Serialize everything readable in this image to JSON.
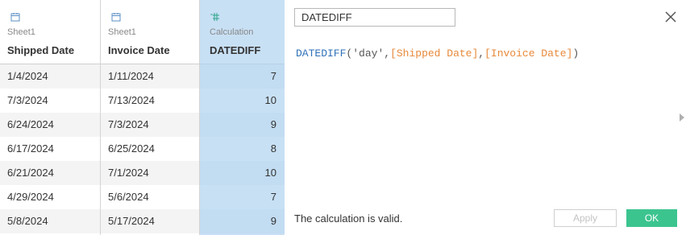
{
  "columns": [
    {
      "source": "Sheet1",
      "title": "Shipped Date",
      "icon": "calendar-icon"
    },
    {
      "source": "Sheet1",
      "title": "Invoice Date",
      "icon": "calendar-icon"
    },
    {
      "source": "Calculation",
      "title": "DATEDIFF",
      "icon": "calculated-field-icon"
    }
  ],
  "rows": [
    [
      "1/4/2024",
      "1/11/2024",
      "7"
    ],
    [
      "7/3/2024",
      "7/13/2024",
      "10"
    ],
    [
      "6/24/2024",
      "7/3/2024",
      "9"
    ],
    [
      "6/17/2024",
      "6/25/2024",
      "8"
    ],
    [
      "6/21/2024",
      "7/1/2024",
      "10"
    ],
    [
      "4/29/2024",
      "5/6/2024",
      "7"
    ],
    [
      "5/8/2024",
      "5/17/2024",
      "9"
    ]
  ],
  "editor": {
    "calc_name": "DATEDIFF",
    "formula": {
      "func": "DATEDIFF",
      "open": "(",
      "arg1": "'day'",
      "comma1": ",",
      "arg2": "[Shipped Date]",
      "comma2": ",",
      "arg3": "[Invoice Date]",
      "close": ")"
    },
    "status": "The calculation is valid.",
    "apply_label": "Apply",
    "ok_label": "OK"
  },
  "colors": {
    "calc_column_bg": "#c8e0f4",
    "function": "#2f72b8",
    "field": "#e8893a",
    "ok_button": "#3cc48f"
  }
}
